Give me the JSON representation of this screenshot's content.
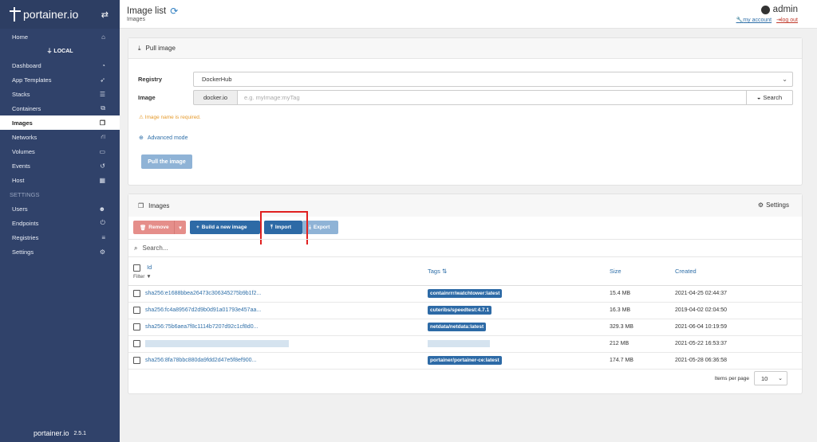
{
  "brand": {
    "name": "portainer.io",
    "version": "2.5.1"
  },
  "sidebar": {
    "items": [
      {
        "label": "Home",
        "icon": "home-icon",
        "glyph": "⌂"
      },
      {
        "label": "Dashboard",
        "icon": "tachometer-icon",
        "glyph": "◔"
      },
      {
        "label": "App Templates",
        "icon": "rocket-icon",
        "glyph": "➶"
      },
      {
        "label": "Stacks",
        "icon": "th-list-icon",
        "glyph": "☰"
      },
      {
        "label": "Containers",
        "icon": "cubes-icon",
        "glyph": "⧉"
      },
      {
        "label": "Images",
        "icon": "clone-icon",
        "glyph": "❐"
      },
      {
        "label": "Networks",
        "icon": "sitemap-icon",
        "glyph": "⛙"
      },
      {
        "label": "Volumes",
        "icon": "hdd-icon",
        "glyph": "▭"
      },
      {
        "label": "Events",
        "icon": "history-icon",
        "glyph": "↺"
      },
      {
        "label": "Host",
        "icon": "th-icon",
        "glyph": "▦"
      },
      {
        "label": "Users",
        "icon": "users-icon",
        "glyph": "👥"
      },
      {
        "label": "Endpoints",
        "icon": "plug-icon",
        "glyph": "⏻"
      },
      {
        "label": "Registries",
        "icon": "database-icon",
        "glyph": "≡"
      },
      {
        "label": "Settings",
        "icon": "cogs-icon",
        "glyph": "⚙"
      }
    ],
    "local_label": "LOCAL",
    "settings_section": "SETTINGS"
  },
  "header": {
    "title": "Image list",
    "breadcrumb": "Images",
    "user": "admin",
    "my_account": "my account",
    "log_out": "log out"
  },
  "pull": {
    "title": "Pull image",
    "registry_label": "Registry",
    "registry_value": "DockerHub",
    "image_label": "Image",
    "image_prefix": "docker.io",
    "image_placeholder": "e.g. myImage:myTag",
    "search_label": "Search",
    "warning": "Image name is required.",
    "advanced": "Advanced mode",
    "pull_button": "Pull the image"
  },
  "images": {
    "title": "Images",
    "settings": "Settings",
    "remove": "Remove",
    "build": "Build a new image",
    "import": "Import",
    "export": "Export",
    "search_placeholder": "Search...",
    "columns": {
      "id": "Id",
      "filter": "Filter",
      "tags": "Tags",
      "size": "Size",
      "created": "Created"
    },
    "rows": [
      {
        "id": "sha256:e1688bbea26473c306345275b9b1f2...",
        "tag": "containrrr/watchtower:latest",
        "size": "15.4 MB",
        "created": "2021-04-25 02:44:37"
      },
      {
        "id": "sha256:fc4a89567d2d9b0d91a01793e457aa...",
        "tag": "cuteribs/speedtest:4.7.1",
        "size": "16.3 MB",
        "created": "2019-04-02 02:04:50"
      },
      {
        "id": "sha256:75b6aea7f8c1114b7207d92c1cf8d0...",
        "tag": "netdata/netdata:latest",
        "size": "329.3 MB",
        "created": "2021-06-04 10:19:59"
      },
      {
        "id": "",
        "tag": "",
        "size": "212 MB",
        "created": "2021-05-22 16:53:37"
      },
      {
        "id": "sha256:8fa78bbc880da9fdd2d47e5f8ef900...",
        "tag": "portainer/portainer-ce:latest",
        "size": "174.7 MB",
        "created": "2021-05-28 06:36:58"
      }
    ],
    "items_per_page_label": "Items per page",
    "items_per_page": "10"
  }
}
